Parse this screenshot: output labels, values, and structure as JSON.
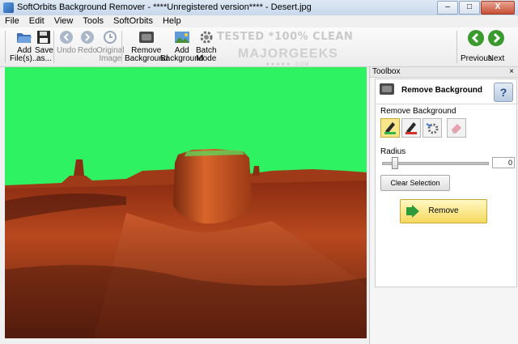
{
  "window": {
    "title": "SoftOrbits Background Remover - ****Unregistered version**** - Desert.jpg",
    "minimize": "–",
    "maximize": "□",
    "close": "X"
  },
  "menu": [
    "File",
    "Edit",
    "View",
    "Tools",
    "SoftOrbits",
    "Help"
  ],
  "toolbar": {
    "add_files": [
      "Add",
      "File(s)..."
    ],
    "save_as": [
      "Save",
      "as..."
    ],
    "undo": "Undo",
    "redo": "Redo",
    "original_image": [
      "Original",
      "Image"
    ],
    "remove_background": [
      "Remove",
      "Background"
    ],
    "add_background": [
      "Add",
      "Background"
    ],
    "batch_mode": [
      "Batch",
      "Mode"
    ],
    "previous": "Previous",
    "next": "Next"
  },
  "watermark": {
    "line1": "TESTED *100% CLEAN",
    "line2": "MAJORGEEKS",
    "line3": "★★★★★ .COM"
  },
  "toolbox": {
    "header": "Toolbox",
    "close": "×",
    "panel_title": "Remove Background",
    "help": "?",
    "section_label": "Remove Background",
    "radius_label": "Radius",
    "radius_value": "0",
    "radius_fraction": 0.1,
    "clear_selection": "Clear Selection",
    "remove": "Remove"
  },
  "colors": {
    "selection_green": "#2ef262",
    "accent_yellow": "#f5d95e"
  },
  "icons": {
    "add_files": "folder-open-icon",
    "save_as": "floppy-disk-icon",
    "undo": "undo-arrow-icon",
    "redo": "redo-arrow-icon",
    "original_image": "clock-icon",
    "remove_background": "photo-frame-icon",
    "add_background": "landscape-photo-icon",
    "batch_mode": "gear-icon",
    "previous": "green-left-arrow-icon",
    "next": "green-right-arrow-icon"
  }
}
